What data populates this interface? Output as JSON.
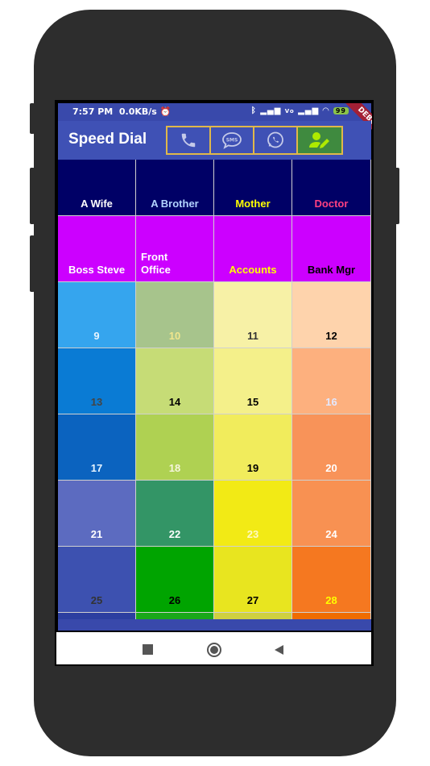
{
  "status_bar": {
    "time": "7:57 PM",
    "speed": "0.0KB/s",
    "icons": [
      "alarm-icon",
      "bluetooth-icon",
      "signal-icon",
      "vowifi-icon",
      "wifi-icon",
      "battery-icon"
    ],
    "battery": "99",
    "debug_banner": "DEBUG"
  },
  "app": {
    "title": "Speed Dial",
    "actions": [
      {
        "name": "call-icon",
        "selected": false
      },
      {
        "name": "sms-icon",
        "selected": false
      },
      {
        "name": "whatsapp-icon",
        "selected": false
      },
      {
        "name": "edit-contact-icon",
        "selected": true
      }
    ]
  },
  "grid": {
    "rows": [
      [
        {
          "label": "A Wife",
          "bg": "#000066",
          "fg": "#ffffff"
        },
        {
          "label": "A Brother",
          "bg": "#000066",
          "fg": "#b3d4ff"
        },
        {
          "label": "Mother",
          "bg": "#000066",
          "fg": "#ffff00"
        },
        {
          "label": "Doctor",
          "bg": "#000066",
          "fg": "#ff4081"
        }
      ],
      [
        {
          "label": "Boss Steve",
          "bg": "#cc00ff",
          "fg": "#ffffff"
        },
        {
          "label": "Front Office",
          "bg": "#cc00ff",
          "fg": "#ffffff"
        },
        {
          "label": "Accounts",
          "bg": "#cc00ff",
          "fg": "#ffff00"
        },
        {
          "label": "Bank Mgr",
          "bg": "#cc00ff",
          "fg": "#000000"
        }
      ],
      [
        {
          "label": "9",
          "bg": "#35a5ee",
          "fg": "#e6f4ff"
        },
        {
          "label": "10",
          "bg": "#a7c48c",
          "fg": "#f0e68c"
        },
        {
          "label": "11",
          "bg": "#f7f1a6",
          "fg": "#333333"
        },
        {
          "label": "12",
          "bg": "#fed3ac",
          "fg": "#000000"
        }
      ],
      [
        {
          "label": "13",
          "bg": "#0a7bd4",
          "fg": "#444444"
        },
        {
          "label": "14",
          "bg": "#c6dc76",
          "fg": "#000000"
        },
        {
          "label": "15",
          "bg": "#f4f08a",
          "fg": "#000000"
        },
        {
          "label": "16",
          "bg": "#fdb07e",
          "fg": "#e3e8ff"
        }
      ],
      [
        {
          "label": "17",
          "bg": "#0b63bf",
          "fg": "#e6f4ff"
        },
        {
          "label": "18",
          "bg": "#afd152",
          "fg": "#f5f5dc"
        },
        {
          "label": "19",
          "bg": "#f1ec5c",
          "fg": "#000000"
        },
        {
          "label": "20",
          "bg": "#f89359",
          "fg": "#ffffff"
        }
      ],
      [
        {
          "label": "21",
          "bg": "#5c6bc0",
          "fg": "#ffffff"
        },
        {
          "label": "22",
          "bg": "#339566",
          "fg": "#ffffff"
        },
        {
          "label": "23",
          "bg": "#f2ea15",
          "fg": "#fff9c4"
        },
        {
          "label": "24",
          "bg": "#f89152",
          "fg": "#ffffff"
        }
      ],
      [
        {
          "label": "25",
          "bg": "#3d51b0",
          "fg": "#333333"
        },
        {
          "label": "26",
          "bg": "#00a400",
          "fg": "#000000"
        },
        {
          "label": "27",
          "bg": "#e8e51f",
          "fg": "#000000"
        },
        {
          "label": "28",
          "bg": "#f57820",
          "fg": "#ffff00"
        }
      ],
      [
        {
          "label": "",
          "bg": "#2c3fa0",
          "fg": "#ffffff"
        },
        {
          "label": "",
          "bg": "#1aa81a",
          "fg": "#ffffff"
        },
        {
          "label": "",
          "bg": "#cfd040",
          "fg": "#ffffff"
        },
        {
          "label": "",
          "bg": "#ef6c00",
          "fg": "#ffffff"
        }
      ]
    ]
  },
  "nav_bar": {
    "buttons": [
      "recents-square-icon",
      "home-circle-icon",
      "back-triangle-icon"
    ]
  }
}
